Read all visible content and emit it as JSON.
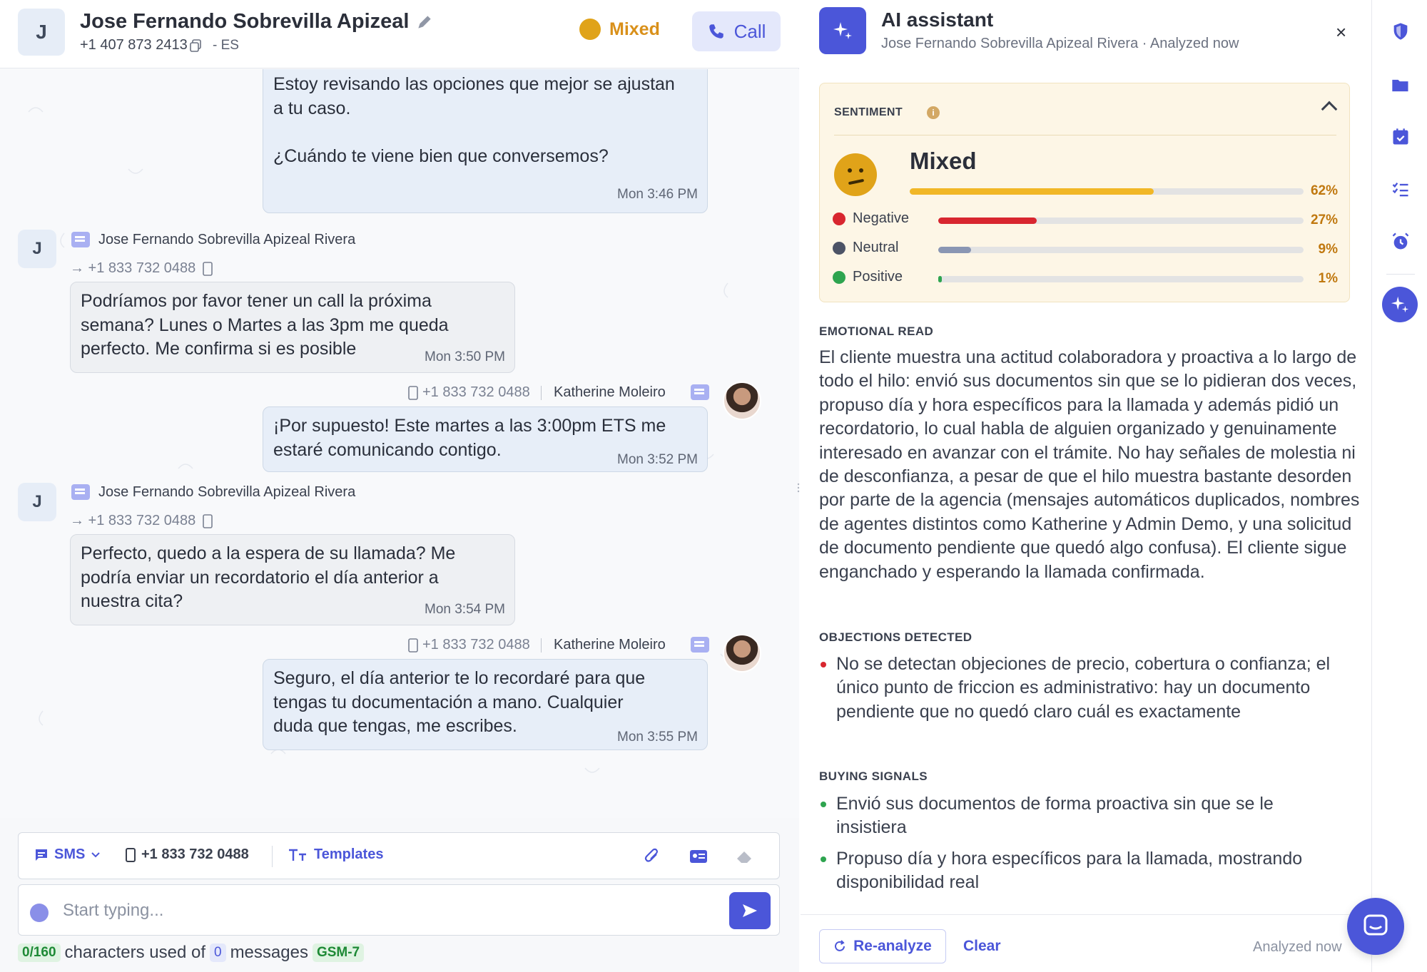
{
  "header": {
    "avatar_initial": "J",
    "contact_name": "Jose Fernando Sobrevilla Apizeal",
    "phone": "+1 407 873 2413",
    "language": "- ES",
    "sentiment_label": "Mixed",
    "call_label": "Call"
  },
  "messages": [
    {
      "type": "out",
      "lines": [
        "Estoy revisando las opciones que mejor se ajustan",
        "a tu caso.",
        "",
        "¿Cuándo te viene bien que conversemos?"
      ],
      "time": "Mon 3:46 PM"
    },
    {
      "type": "in",
      "initial": "J",
      "sender": "Jose Fernando Sobrevilla Apizeal Rivera",
      "to": "→ +1 833 732 0488",
      "lines": [
        "Podríamos por favor tener un call la próxima",
        "semana? Lunes o Martes a las 3pm me queda",
        "perfecto. Me confirma si es posible"
      ],
      "time": "Mon 3:50 PM"
    },
    {
      "type": "out",
      "from_phone": "+1 833 732 0488",
      "agent": "Katherine Moleiro",
      "lines": [
        "¡Por supuesto! Este martes a las 3:00pm ETS me",
        "estaré comunicando contigo."
      ],
      "time": "Mon 3:52 PM"
    },
    {
      "type": "in",
      "initial": "J",
      "sender": "Jose Fernando Sobrevilla Apizeal Rivera",
      "to": "→ +1 833 732 0488",
      "lines": [
        "Perfecto, quedo a la espera de su llamada? Me",
        "podría enviar un recordatorio el día anterior a",
        "nuestra cita?"
      ],
      "time": "Mon 3:54 PM"
    },
    {
      "type": "out",
      "from_phone": "+1 833 732 0488",
      "agent": "Katherine Moleiro",
      "lines": [
        "Seguro, el día anterior te lo recordaré para que",
        "tengas tu documentación a mano. Cualquier",
        "duda que tengas, me escribes."
      ],
      "time": "Mon 3:55 PM"
    }
  ],
  "composer": {
    "channel": "SMS",
    "from_number": "+1 833 732 0488",
    "templates_label": "Templates",
    "placeholder": "Start typing...",
    "char_count": "0/160",
    "chars_text": "characters used of",
    "msg_count": "0",
    "messages_text": "messages",
    "encoding": "GSM-7"
  },
  "assistant": {
    "title": "AI assistant",
    "subtitle": "Jose Fernando Sobrevilla Apizeal Rivera · Analyzed now",
    "close": "×",
    "sentiment_section": "SENTIMENT",
    "overall_label": "Mixed",
    "overall_pct": "62%",
    "overall_value": 0.62,
    "breakdown": [
      {
        "label": "Negative",
        "pct": "27%",
        "value": 0.27,
        "color": "#d8262f"
      },
      {
        "label": "Neutral",
        "pct": "9%",
        "value": 0.09,
        "color": "#8a96b3"
      },
      {
        "label": "Positive",
        "pct": "1%",
        "value": 0.01,
        "color": "#2ea44f"
      }
    ],
    "emotional_read_title": "EMOTIONAL READ",
    "emotional_read": "El cliente muestra una actitud colaboradora y proactiva a lo largo de todo el hilo: envió sus documentos sin que se lo pidieran dos veces, propuso día y hora específicos para la llamada y además pidió un recordatorio, lo cual habla de alguien organizado y genuinamente interesado en avanzar con el trámite. No hay señales de molestia ni de desconfianza, a pesar de que el hilo muestra bastante desorden por parte de la agencia (mensajes automáticos duplicados, nombres de agentes distintos como Katherine y Admin Demo, y una solicitud de documento pendiente que quedó algo confusa). El cliente sigue enganchado y esperando la llamada confirmada.",
    "objections_title": "OBJECTIONS DETECTED",
    "objections": [
      "No se detectan objeciones de precio, cobertura o confianza; el único punto de friccion es administrativo: hay un documento pendiente que no quedó claro cuál es exactamente"
    ],
    "buying_title": "BUYING SIGNALS",
    "buying": [
      "Envió sus documentos de forma proactiva sin que se le insistiera",
      "Propuso día y hora específicos para la llamada, mostrando disponibilidad real"
    ],
    "reanalyze_label": "Re-analyze",
    "clear_label": "Clear",
    "footer_status": "Analyzed now"
  },
  "colors": {
    "accent": "#4b56d9",
    "mixed": "#e0a319",
    "negative": "#d8262f",
    "positive": "#2ea44f"
  }
}
